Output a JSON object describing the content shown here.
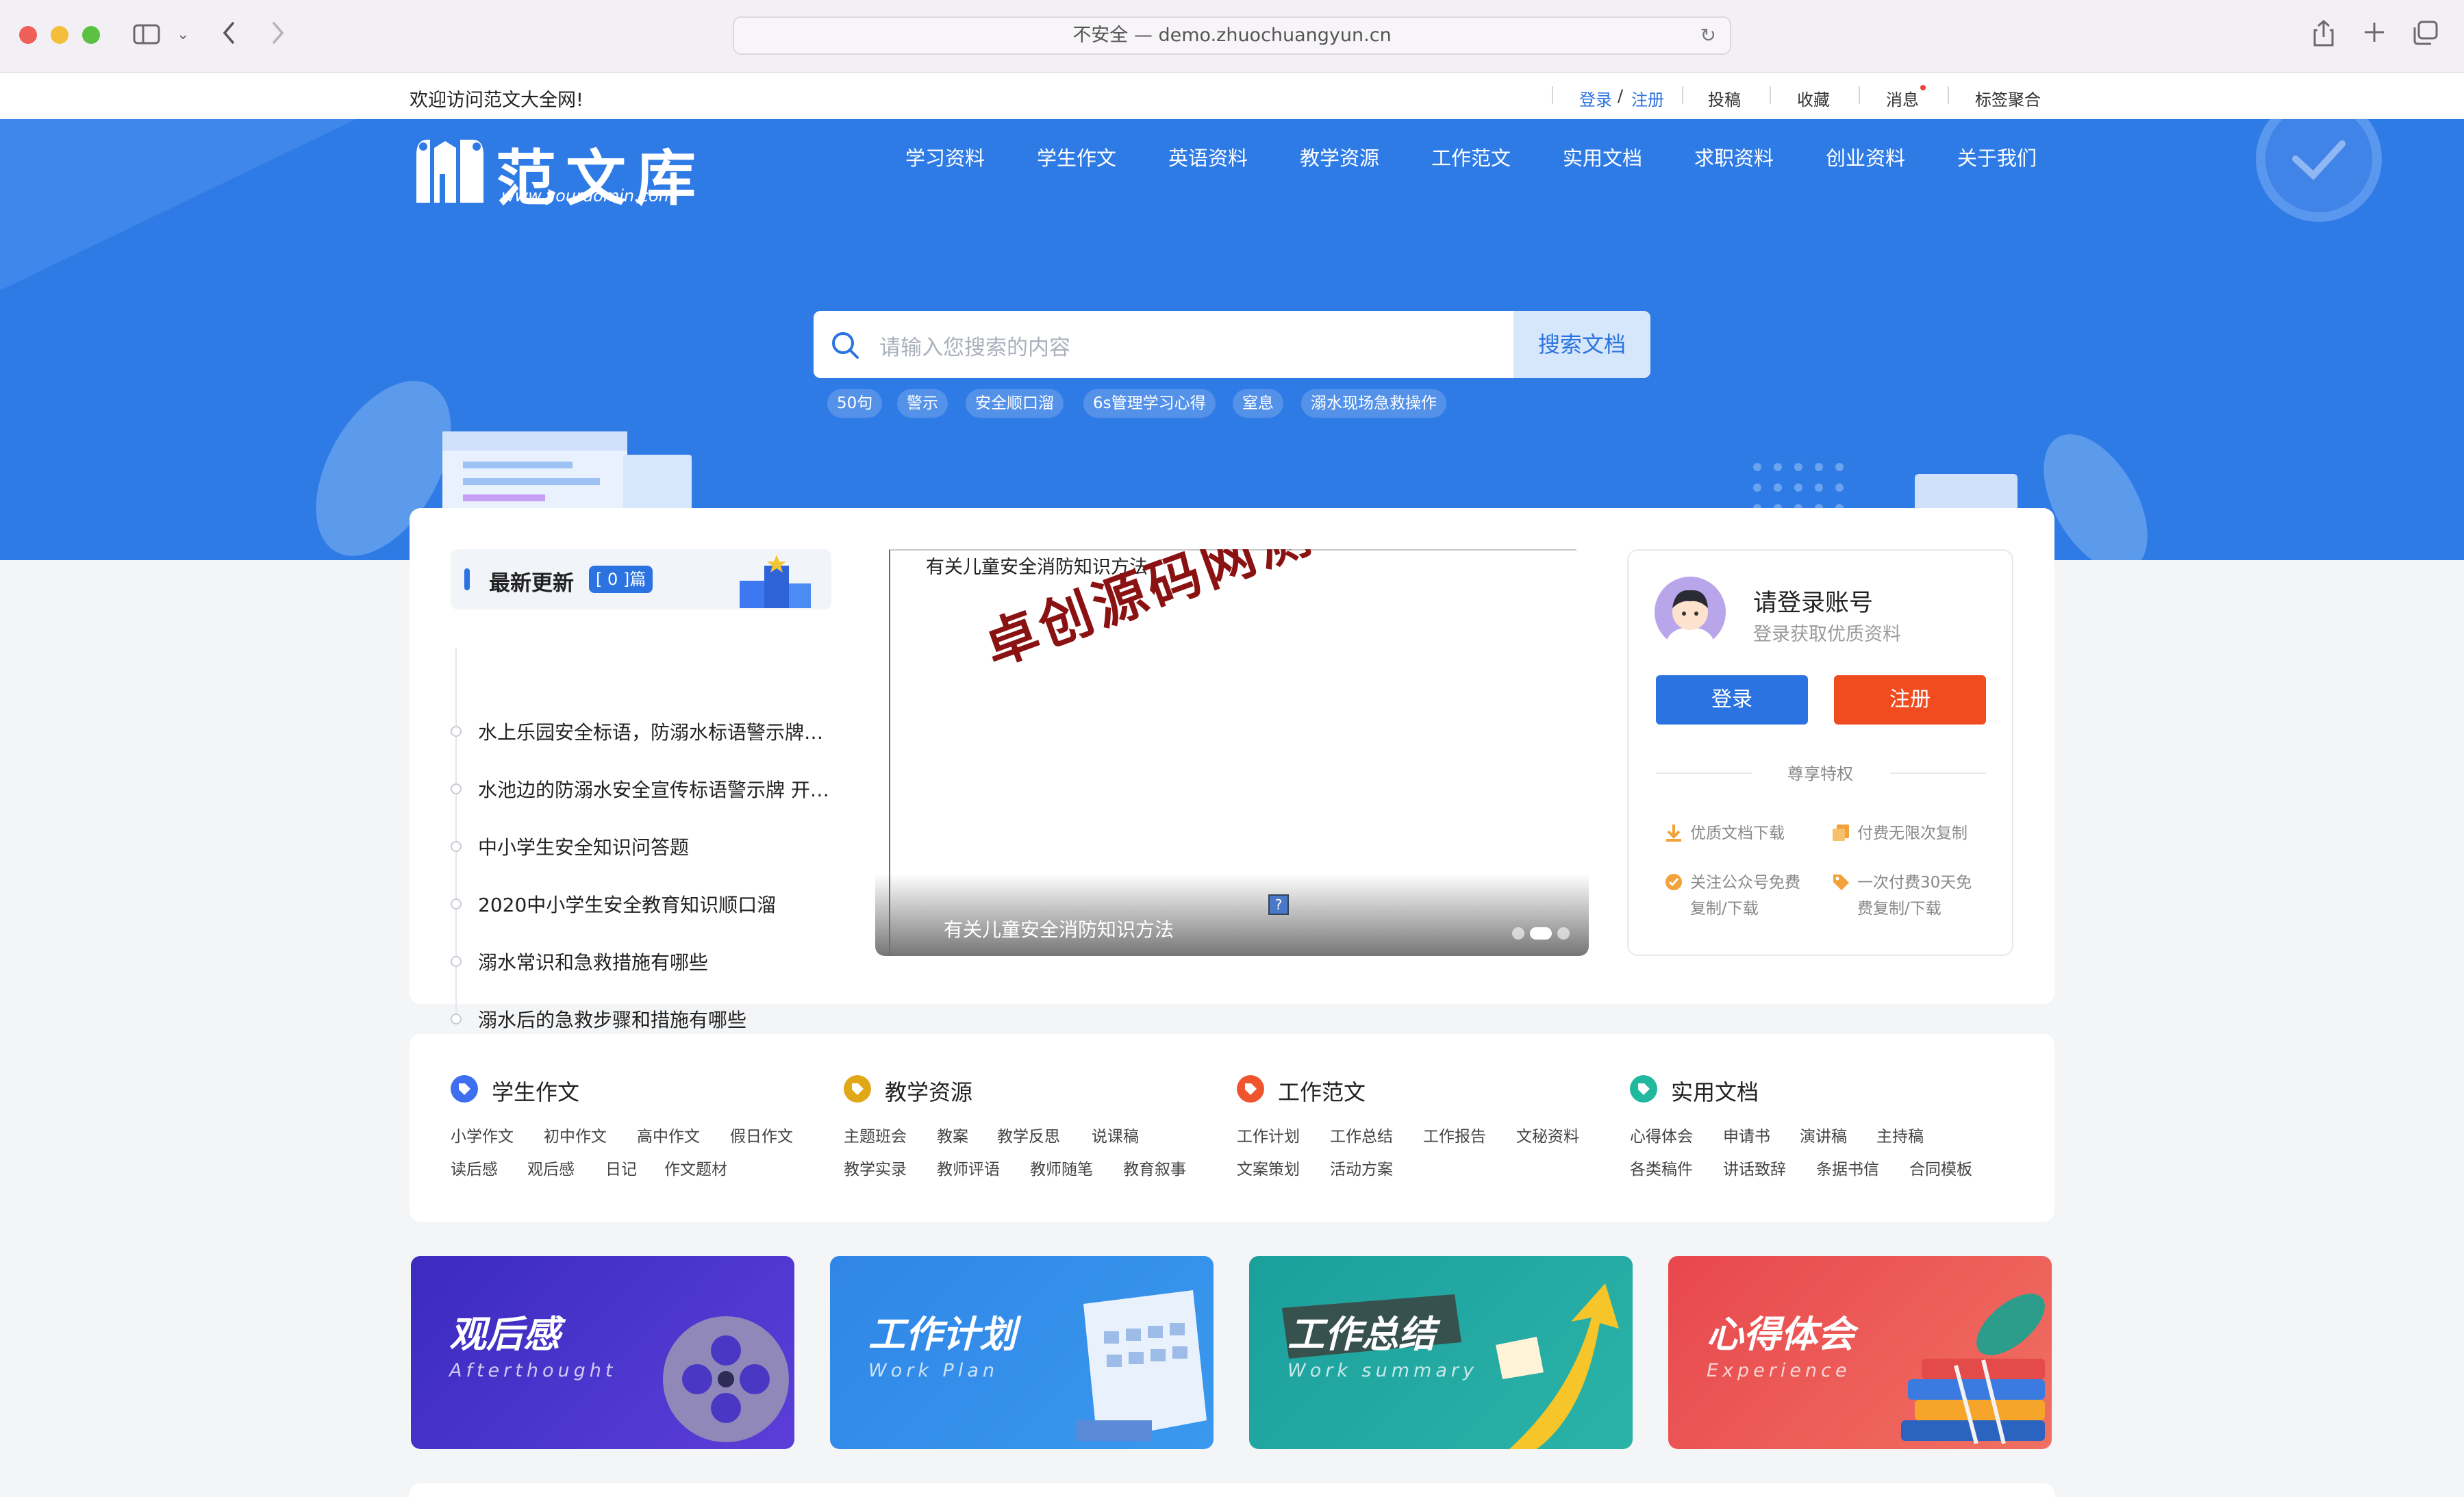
{
  "browser": {
    "url_text": "不安全 — demo.zhuochuangyun.cn"
  },
  "topbar": {
    "welcome": "欢迎访问范文大全网!",
    "login": "登录",
    "slash": "/",
    "register": "注册",
    "links": [
      "投稿",
      "收藏",
      "消息",
      "标签聚合"
    ]
  },
  "header": {
    "logo_text": "范文库",
    "logo_domain": "www.yourdomin.com",
    "nav": [
      "学习资料",
      "学生作文",
      "英语资料",
      "教学资源",
      "工作范文",
      "实用文档",
      "求职资料",
      "创业资料",
      "关于我们"
    ]
  },
  "search": {
    "placeholder": "请输入您搜索的内容",
    "button": "搜索文档",
    "tags": [
      "50句",
      "警示",
      "安全顺口溜",
      "6s管理学习心得",
      "窒息",
      "溺水现场急救操作"
    ]
  },
  "latest": {
    "title": "最新更新",
    "count": "[ 0 ]篇",
    "items": [
      "水上乐园安全标语，防溺水标语警示牌…",
      "水池边的防溺水安全宣传标语警示牌 开…",
      "中小学生安全知识问答题",
      "2020中小学生安全教育知识顺口溜",
      "溺水常识和急救措施有哪些",
      "溺水后的急救步骤和措施有哪些"
    ]
  },
  "slider": {
    "image_alt": "有关儿童安全消防知识方法",
    "watermark": "卓创源码网测试",
    "caption": "有关儿童安全消防知识方法",
    "broken_icon": "?"
  },
  "account": {
    "title": "请登录账号",
    "subtitle": "登录获取优质资料",
    "login_btn": "登录",
    "register_btn": "注册",
    "divider": "尊享特权",
    "perks": [
      {
        "icon": "download-icon",
        "text": "优质文档下载"
      },
      {
        "icon": "copy-icon",
        "text": "付费无限次复制"
      },
      {
        "icon": "check-badge-icon",
        "text": "关注公众号免费复制/下载"
      },
      {
        "icon": "tag-icon",
        "text": "一次付费30天免费复制/下载"
      }
    ]
  },
  "categories": [
    {
      "title": "学生作文",
      "color": "#3e6ff0",
      "row1": [
        "小学作文",
        "初中作文",
        "高中作文",
        "假日作文"
      ],
      "row2": [
        "读后感",
        "观后感",
        "日记",
        "作文题材"
      ]
    },
    {
      "title": "教学资源",
      "color": "#e0a816",
      "row1": [
        "主题班会",
        "教案",
        "教学反思",
        "说课稿"
      ],
      "row2": [
        "教学实录",
        "教师评语",
        "教师随笔",
        "教育叙事"
      ]
    },
    {
      "title": "工作范文",
      "color": "#f0542e",
      "row1": [
        "工作计划",
        "工作总结",
        "工作报告",
        "文秘资料"
      ],
      "row2": [
        "文案策划",
        "活动方案"
      ]
    },
    {
      "title": "实用文档",
      "color": "#22b8a0",
      "row1": [
        "心得体会",
        "申请书",
        "演讲稿",
        "主持稿"
      ],
      "row2": [
        "各类稿件",
        "讲话致辞",
        "条据书信",
        "合同模板"
      ]
    }
  ],
  "banners": [
    {
      "title": "观后感",
      "subtitle": "Afterthought",
      "color": "#4a2fc8"
    },
    {
      "title": "工作计划",
      "subtitle": "Work Plan",
      "color": "#2f86e6"
    },
    {
      "title": "工作总结",
      "subtitle": "Work summary",
      "color": "#1fa6a0"
    },
    {
      "title": "心得体会",
      "subtitle": "Experience",
      "color": "#e84c4c"
    }
  ]
}
